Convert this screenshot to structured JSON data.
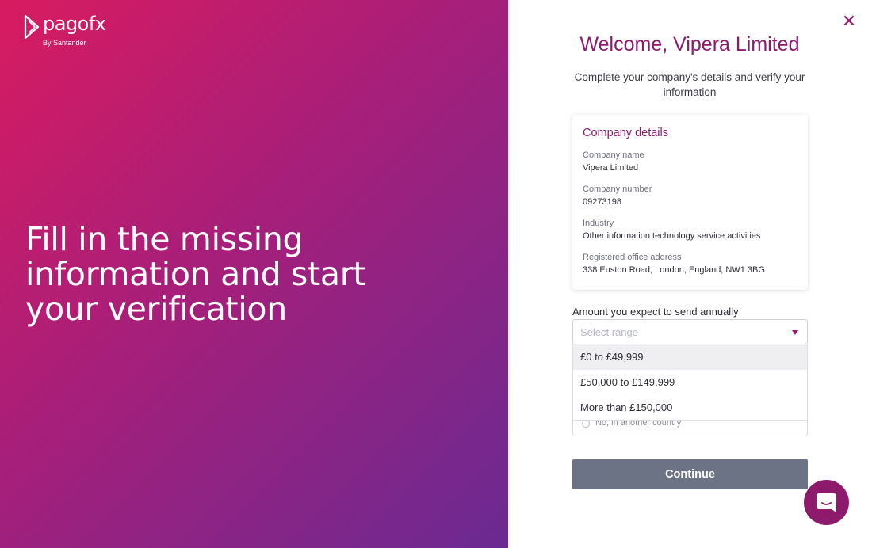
{
  "brand": {
    "logo_text": "pagofx",
    "logo_sub": "By Santander"
  },
  "hero": {
    "line1": "Fill in the missing",
    "line2": "information and start",
    "line3": "your verification"
  },
  "header": {
    "welcome": "Welcome, Vipera Limited",
    "subtitle": "Complete your company's details and verify your information",
    "close_icon": "close-icon"
  },
  "company_details": {
    "title": "Company details",
    "fields": [
      {
        "label": "Company name",
        "value": "Vipera Limited"
      },
      {
        "label": "Company number",
        "value": "09273198"
      },
      {
        "label": "Industry",
        "value": "Other information technology service activities"
      },
      {
        "label": "Registered office address",
        "value": "338 Euston Road, London, England, NW1 3BG"
      }
    ]
  },
  "amount": {
    "label": "Amount you expect to send annually",
    "placeholder": "Select range",
    "options": [
      "£0 to £49,999",
      "£50,000 to £149,999",
      "More than £150,000"
    ]
  },
  "partial_radio": {
    "label": "No, in another country"
  },
  "actions": {
    "continue_label": "Continue"
  },
  "colors": {
    "accent": "#8e1a6c",
    "gradient_start": "#d81b60",
    "gradient_end": "#6a2a92",
    "button": "#6b7384"
  }
}
